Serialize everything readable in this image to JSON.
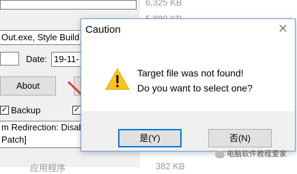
{
  "background_app": {
    "exe_field": "Out.exe, Style Build",
    "date_label": "Date:",
    "date_value": "19-11-",
    "about_button": "About",
    "backup_label": "Backup",
    "status_line1": "m Redirection: Disab",
    "status_line2": "Patch]"
  },
  "background_list": {
    "sizes": [
      "6,325 KB",
      "5,880 KB",
      "382 KB"
    ],
    "type_label": "应用程序"
  },
  "dialog": {
    "title": "Caution",
    "message_line1": "Target file was not found!",
    "message_line2": "Do you want to select one?",
    "yes_label": "是(Y)",
    "no_label": "否(N)"
  },
  "watermark": {
    "text": "电脑软件教程爱家"
  },
  "colors": {
    "arrow": "#e23b3b",
    "focus_border": "#0078d7",
    "warning_fill": "#fcc419"
  }
}
